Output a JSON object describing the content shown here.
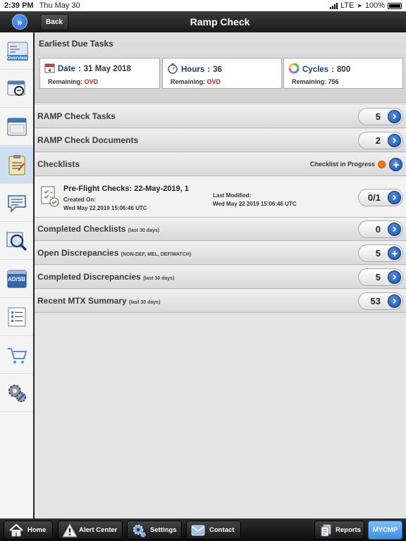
{
  "status_bar": {
    "time": "2:39 PM",
    "date": "Thu May 30",
    "network": "LTE",
    "battery": "100%"
  },
  "header": {
    "back_label": "Back",
    "title": "Ramp Check"
  },
  "sidebar": {
    "items": [
      {
        "icon": "overview-icon",
        "label": "Overview"
      },
      {
        "icon": "aircraft-search-icon"
      },
      {
        "icon": "window-icon"
      },
      {
        "icon": "clipboard-icon"
      },
      {
        "icon": "chat-icon"
      },
      {
        "icon": "magnifier-icon"
      },
      {
        "icon": "ad-sb-icon",
        "label": "AD/SB"
      },
      {
        "icon": "list-icon"
      },
      {
        "icon": "cart-icon"
      },
      {
        "icon": "gears-icon"
      }
    ]
  },
  "earliest_due": {
    "title": "Earliest Due Tasks",
    "date": {
      "label": "Date",
      "value": "31 May 2018",
      "remaining_label": "Remaining:",
      "remaining_value": "OVD"
    },
    "hours": {
      "label": "Hours",
      "value": "36",
      "remaining_label": "Remaining:",
      "remaining_value": "OVD"
    },
    "cycles": {
      "label": "Cycles",
      "value": "800",
      "remaining_label": "Remaining:",
      "remaining_value": "756"
    }
  },
  "rows": {
    "ramp_tasks": {
      "label": "RAMP Check Tasks",
      "count": "5"
    },
    "ramp_documents": {
      "label": "RAMP Check Documents",
      "count": "2"
    },
    "checklists": {
      "label": "Checklists",
      "status": "Checklist in Progress"
    },
    "completed_checklists": {
      "label": "Completed Checklists",
      "note": "(last 30 days)",
      "count": "0"
    },
    "open_discrepancies": {
      "label": "Open Discrepancies",
      "note": "(NON-DEF, MEL, DEF/WATCH)",
      "count": "5"
    },
    "completed_discrepancies": {
      "label": "Completed Discrepancies",
      "note": "(last 30 days)",
      "count": "5"
    },
    "recent_mtx": {
      "label": "Recent MTX Summary",
      "note": "(last 30 days)",
      "count": "53"
    }
  },
  "checklist_item": {
    "title": "Pre-Flight Checks: 22-May-2019, 1",
    "created_label": "Created On:",
    "created_value": "Wed May 22 2019 15:06:46 UTC",
    "modified_label": "Last Modified:",
    "modified_value": "Wed May 22 2019 15:06:46 UTC",
    "progress": "0/1"
  },
  "bottom_bar": {
    "home": "Home",
    "alert_center": "Alert Center",
    "settings": "Settings",
    "contact": "Contact",
    "reports": "Reports",
    "mycmp": "MYCMP"
  },
  "colors": {
    "accent_blue": "#1c4fb0",
    "overdue_red": "#d01e1e",
    "in_progress_orange": "#f07a1a",
    "header_dark": "#1a1a1a"
  }
}
